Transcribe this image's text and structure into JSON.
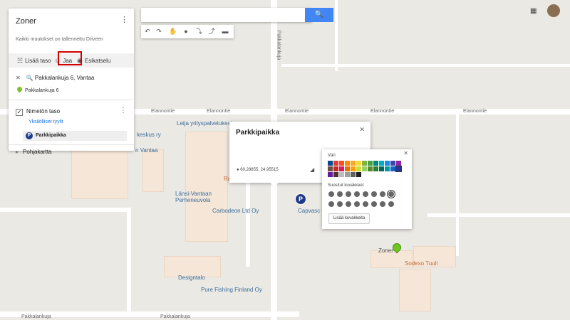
{
  "panel": {
    "title": "Zoner",
    "status": "Kaikki muutokset on tallennettu Driveen",
    "actions": {
      "add_layer": "Lisää taso",
      "share": "Jaa",
      "preview": "Esikatselu"
    },
    "search_query": "Pakkalankuja 6, Vantaa",
    "search_result": "Pakkalankuja 6",
    "layer_name": "Nimetön taso",
    "layer_styles": "Yksilölliset tyylit",
    "feature_name": "Parkkipaikka",
    "base_map": "Pohjakartta"
  },
  "info_window": {
    "title": "Parkkipaikka",
    "coords": "60.28855, 24.95515"
  },
  "style_popup": {
    "color_label": "Väri",
    "icons_label": "Suositut kuvakkeet",
    "more_icons_button": "Lisää kuvakkeita",
    "colors": [
      "#0b4a8a",
      "#e53935",
      "#f4511e",
      "#fb8c00",
      "#f9a825",
      "#fdd835",
      "#7cb342",
      "#43a047",
      "#00897b",
      "#00acc1",
      "#1e88e5",
      "#3949ab",
      "#8e24aa",
      "#6d4c41",
      "#c62828",
      "#d81b60",
      "#ef6c00",
      "#ffa000",
      "#cddc39",
      "#9ccc65",
      "#558b2f",
      "#2e7d32",
      "#00695c",
      "#0097a7",
      "#1565c0",
      "#283593",
      "#6a1b9a",
      "#4e342e",
      "#bdbdbd",
      "#9e9e9e",
      "#616161",
      "#212121"
    ],
    "selected_color_index": 25
  },
  "map_labels": {
    "street1": "Elannontie",
    "street2": "Pakkalankuja",
    "street3": "Pakkalankuja",
    "poi_leija": "Leija yrityspalvelukeskus",
    "poi_keskus": "keskus ry",
    "poi_vantaa": "n Vantaa",
    "poi_lansi": "Länsi-Vantaan Perheneuvola",
    "poi_carbodeon": "Carbodeon Ltd Oy",
    "poi_capvasc": "Capvasc C",
    "poi_designtalo": "Designtalo",
    "poi_pure": "Pure Fishing Finland Oy",
    "poi_sodexo": "Sodexo Tuuli",
    "poi_zoner": "Zoner",
    "poi_ra": "Ra"
  }
}
